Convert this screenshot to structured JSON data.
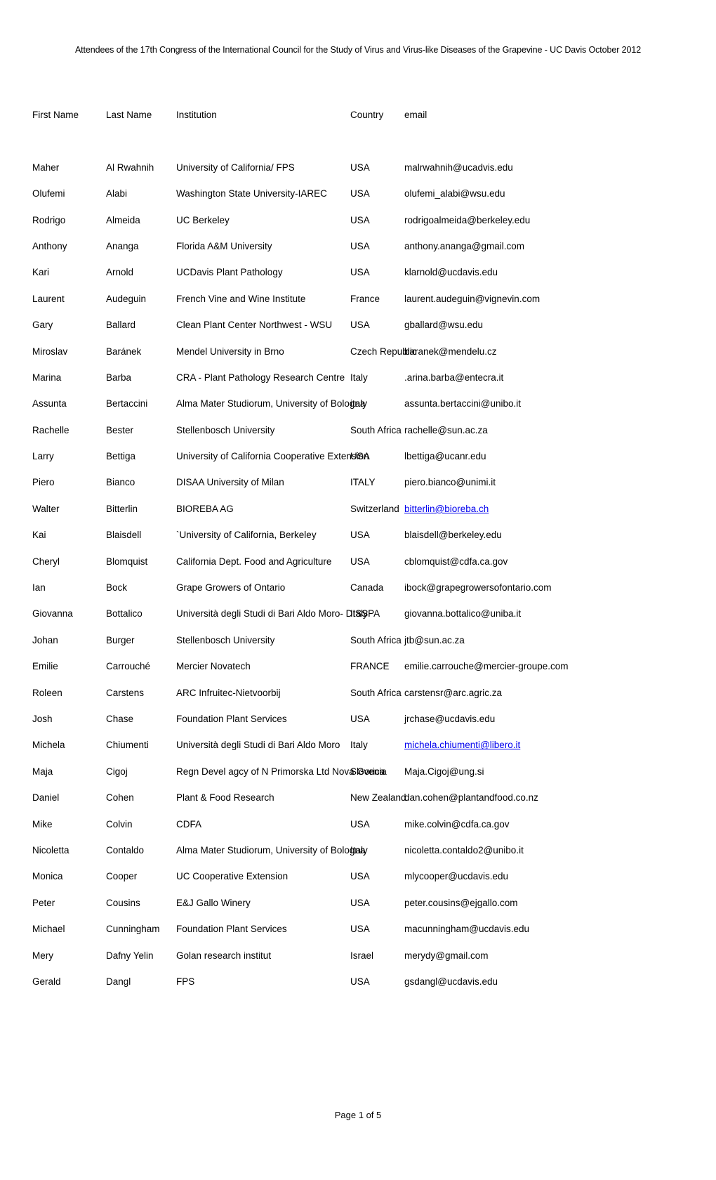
{
  "document": {
    "title": "Attendees of the 17th Congress of the International Council for the Study of Virus and Virus-like Diseases of the Grapevine - UC Davis October 2012",
    "footer": "Page 1 of 5"
  },
  "table": {
    "headers": {
      "first_name": "First Name",
      "last_name": "Last Name",
      "institution": "Institution",
      "country": "Country",
      "email": "email"
    },
    "link_color": "#0000ee",
    "rows": [
      {
        "first_name": "Maher",
        "last_name": "Al Rwahnih",
        "institution": "University of California/  FPS",
        "country": "USA",
        "email": "malrwahnih@ucadvis.edu",
        "email_is_link": false
      },
      {
        "first_name": "Olufemi",
        "last_name": "Alabi",
        "institution": "Washington State University-IAREC",
        "country": "USA",
        "email": "olufemi_alabi@wsu.edu",
        "email_is_link": false
      },
      {
        "first_name": "Rodrigo",
        "last_name": "Almeida",
        "institution": "UC Berkeley",
        "country": "USA",
        "email": "rodrigoalmeida@berkeley.edu",
        "email_is_link": false
      },
      {
        "first_name": "Anthony",
        "last_name": "Ananga",
        "institution": "Florida A&M University",
        "country": "USA",
        "email": "anthony.ananga@gmail.com",
        "email_is_link": false
      },
      {
        "first_name": "Kari",
        "last_name": "Arnold",
        "institution": "UCDavis Plant Pathology",
        "country": "USA",
        "email": "klarnold@ucdavis.edu",
        "email_is_link": false
      },
      {
        "first_name": "Laurent",
        "last_name": "Audeguin",
        "institution": "French Vine and Wine Institute",
        "country": "France",
        "email": "laurent.audeguin@vignevin.com",
        "email_is_link": false
      },
      {
        "first_name": "Gary",
        "last_name": "Ballard",
        "institution": "Clean Plant Center Northwest - WSU",
        "country": "USA",
        "email": "gballard@wsu.edu",
        "email_is_link": false
      },
      {
        "first_name": "Miroslav",
        "last_name": "Baránek",
        "institution": "Mendel University in Brno",
        "country": "Czech Republic",
        "email": "baranek@mendelu.cz",
        "email_is_link": false
      },
      {
        "first_name": "Marina",
        "last_name": "Barba",
        "institution": "CRA - Plant Pathology Research Centre",
        "country": "Italy",
        "email": ".arina.barba@entecra.it",
        "email_is_link": false
      },
      {
        "first_name": "Assunta",
        "last_name": "Bertaccini",
        "institution": "Alma Mater Studiorum, University of Bologna",
        "country": "italy",
        "email": "assunta.bertaccini@unibo.it",
        "email_is_link": false
      },
      {
        "first_name": "Rachelle",
        "last_name": "Bester",
        "institution": "Stellenbosch University",
        "country": "South Africa",
        "email": "rachelle@sun.ac.za",
        "email_is_link": false
      },
      {
        "first_name": "Larry",
        "last_name": "Bettiga",
        "institution": "University of California Cooperative Extension",
        "country": "USA",
        "email": "lbettiga@ucanr.edu",
        "email_is_link": false
      },
      {
        "first_name": "Piero",
        "last_name": "Bianco",
        "institution": "DISAA University of Milan",
        "country": "ITALY",
        "email": "piero.bianco@unimi.it",
        "email_is_link": false
      },
      {
        "first_name": "Walter",
        "last_name": "Bitterlin",
        "institution": "BIOREBA AG",
        "country": "Switzerland",
        "email": "bitterlin@bioreba.ch ",
        "email_is_link": true
      },
      {
        "first_name": "Kai",
        "last_name": "Blaisdell",
        "institution": "`University of California, Berkeley",
        "country": "USA",
        "email": "blaisdell@berkeley.edu",
        "email_is_link": false
      },
      {
        "first_name": "Cheryl",
        "last_name": "Blomquist",
        "institution": "California Dept. Food and Agriculture",
        "country": "USA",
        "email": "cblomquist@cdfa.ca.gov",
        "email_is_link": false
      },
      {
        "first_name": "Ian",
        "last_name": "Bock",
        "institution": "Grape Growers of Ontario",
        "country": "Canada",
        "email": "ibock@grapegrowersofontario.com",
        "email_is_link": false
      },
      {
        "first_name": "Giovanna",
        "last_name": "Bottalico",
        "institution": "Università degli Studi di Bari Aldo Moro- DISSPA",
        "country": "Italy",
        "email": "giovanna.bottalico@uniba.it",
        "email_is_link": false
      },
      {
        "first_name": "Johan",
        "last_name": "Burger",
        "institution": "Stellenbosch University",
        "country": "South Africa",
        "email": "jtb@sun.ac.za",
        "email_is_link": false
      },
      {
        "first_name": "Emilie",
        "last_name": "Carrouché",
        "institution": "Mercier Novatech",
        "country": "FRANCE",
        "email": "emilie.carrouche@mercier-groupe.com",
        "email_is_link": false
      },
      {
        "first_name": "Roleen",
        "last_name": "Carstens",
        "institution": "ARC Infruitec-Nietvoorbij",
        "country": "South Africa",
        "email": "carstensr@arc.agric.za",
        "email_is_link": false
      },
      {
        "first_name": "Josh",
        "last_name": "Chase",
        "institution": "Foundation Plant Services",
        "country": "USA",
        "email": "jrchase@ucdavis.edu",
        "email_is_link": false
      },
      {
        "first_name": "Michela",
        "last_name": "Chiumenti",
        "institution": "Università degli Studi di Bari Aldo Moro",
        "country": "Italy",
        "email": "michela.chiumenti@libero.it ",
        "email_is_link": true
      },
      {
        "first_name": "Maja",
        "last_name": "Cigoj",
        "institution": "Regn Devel agcy of N Primorska Ltd Nova Gorica",
        "country": "Slovenia",
        "email": "Maja.Cigoj@ung.si",
        "email_is_link": false
      },
      {
        "first_name": "Daniel",
        "last_name": "Cohen",
        "institution": "Plant & Food Research",
        "country": "New Zealand",
        "email": "dan.cohen@plantandfood.co.nz",
        "email_is_link": false
      },
      {
        "first_name": "Mike",
        "last_name": "Colvin",
        "institution": "CDFA",
        "country": "USA",
        "email": "mike.colvin@cdfa.ca.gov",
        "email_is_link": false
      },
      {
        "first_name": "Nicoletta",
        "last_name": "Contaldo",
        "institution": "Alma Mater Studiorum, University of Bologna",
        "country": "Italy",
        "email": "nicoletta.contaldo2@unibo.it",
        "email_is_link": false
      },
      {
        "first_name": "Monica",
        "last_name": "Cooper",
        "institution": "UC Cooperative Extension",
        "country": "USA",
        "email": "mlycooper@ucdavis.edu",
        "email_is_link": false
      },
      {
        "first_name": "Peter",
        "last_name": "Cousins",
        "institution": "E&J Gallo Winery",
        "country": "USA",
        "email": "peter.cousins@ejgallo.com",
        "email_is_link": false
      },
      {
        "first_name": "Michael",
        "last_name": "Cunningham",
        "institution": "Foundation Plant Services",
        "country": "USA",
        "email": "macunningham@ucdavis.edu",
        "email_is_link": false
      },
      {
        "first_name": "Mery",
        "last_name": "Dafny Yelin",
        "institution": "Golan research institut",
        "country": "Israel",
        "email": "merydy@gmail.com",
        "email_is_link": false
      },
      {
        "first_name": "Gerald",
        "last_name": "Dangl",
        "institution": "FPS",
        "country": "USA",
        "email": "gsdangl@ucdavis.edu",
        "email_is_link": false
      }
    ]
  }
}
